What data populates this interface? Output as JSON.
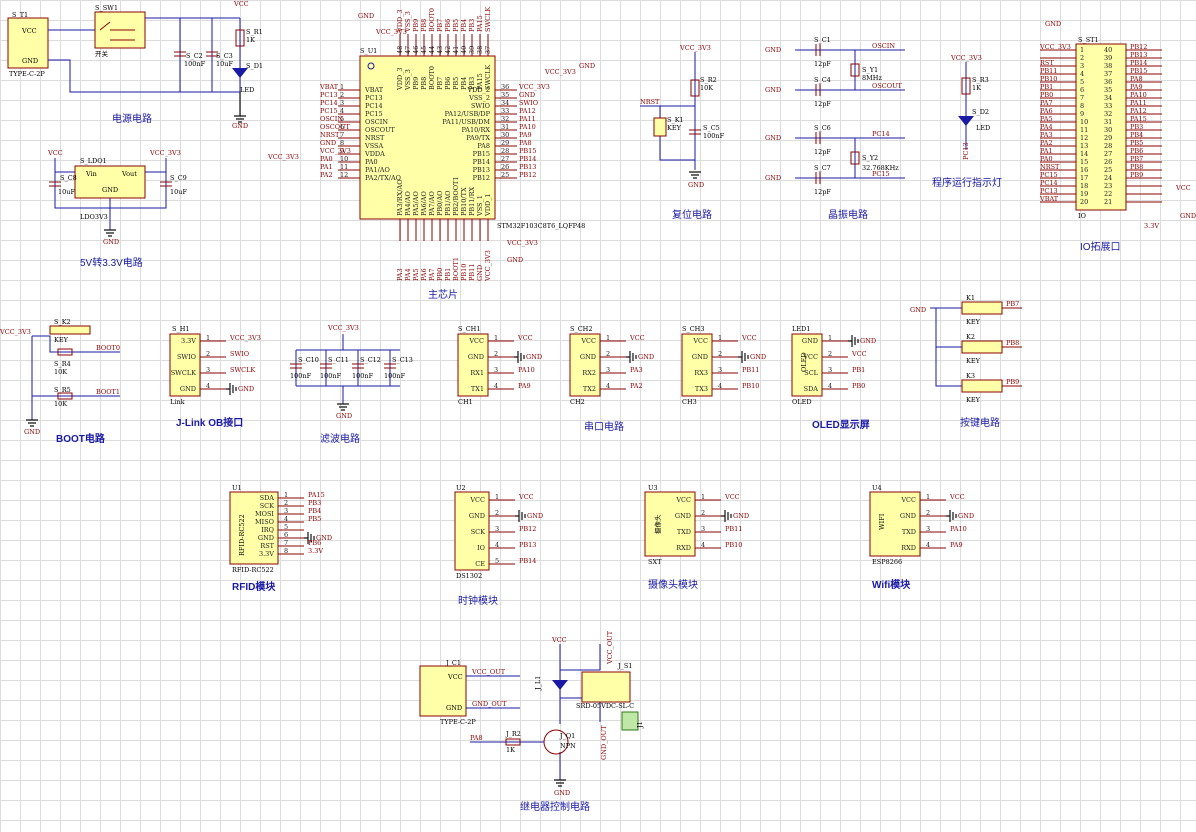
{
  "captions": {
    "power": "电源电路",
    "ldo": "5V转3.3V电路",
    "mcu": "主芯片",
    "reset": "复位电路",
    "crystal": "晶振电路",
    "indicator": "程序运行指示灯",
    "io": "IO拓展口",
    "boot": "BOOT电路",
    "jlink": "J-Link OB接口",
    "filter": "滤波电路",
    "uart": "串口电路",
    "oled": "OLED显示屏",
    "keys": "按键电路",
    "rfid": "RFID模块",
    "clock": "时钟模块",
    "camera": "摄像头模块",
    "wifi": "Wifi模块",
    "relay": "继电器控制电路"
  },
  "power": {
    "t1_ref": "S_T1",
    "t1_name": "TYPE-C-2P",
    "t1_pins": [
      "NC",
      "VCC",
      "NC",
      "GND"
    ],
    "sw_ref": "S_SW1",
    "sw_name": "开关",
    "c2_ref": "S_C2",
    "c2_val": "100nF",
    "c3_ref": "S_C3",
    "c3_val": "10uF",
    "r1_ref": "S_R1",
    "r1_val": "1K",
    "d1_ref": "S_D1",
    "d1_val": "LED",
    "vcc": "VCC",
    "gnd": "GND"
  },
  "ldo": {
    "ref": "S_LDO1",
    "name": "LDO3V3",
    "vin": "Vin",
    "vout": "Vout",
    "gnd_pin": "GND",
    "c8_ref": "S_C8",
    "c8_val": "10uF",
    "c9_ref": "S_C9",
    "c9_val": "10uF",
    "vcc": "VCC",
    "vcc33": "VCC_3V3",
    "gnd": "GND"
  },
  "mcu": {
    "ref": "S_U1",
    "part": "STM32F103C8T6_LQFP48",
    "left_pins": [
      {
        "n": "1",
        "name": "VBAT",
        "net": "VBAT"
      },
      {
        "n": "2",
        "name": "PC13",
        "net": "PC13"
      },
      {
        "n": "3",
        "name": "PC14",
        "net": "PC14"
      },
      {
        "n": "4",
        "name": "PC15",
        "net": "PC15"
      },
      {
        "n": "5",
        "name": "OSCIN",
        "net": "OSCIN"
      },
      {
        "n": "6",
        "name": "OSCOUT",
        "net": "OSCOUT"
      },
      {
        "n": "7",
        "name": "NRST",
        "net": "NRST"
      },
      {
        "n": "8",
        "name": "VSSA",
        "net": "GND"
      },
      {
        "n": "9",
        "name": "VDDA",
        "net": "VCC_3V3"
      },
      {
        "n": "10",
        "name": "PA0",
        "net": "PA0"
      },
      {
        "n": "11",
        "name": "PA1/AO",
        "net": "PA1"
      },
      {
        "n": "12",
        "name": "PA2/TX/AO",
        "net": "PA2"
      }
    ],
    "right_pins": [
      {
        "n": "36",
        "name": "VDD_2",
        "net": "VCC_3V3"
      },
      {
        "n": "35",
        "name": "VSS_2",
        "net": "GND"
      },
      {
        "n": "34",
        "name": "SWIO",
        "net": "SWIO"
      },
      {
        "n": "33",
        "name": "PA12/USB/DP",
        "net": "PA12"
      },
      {
        "n": "32",
        "name": "PA11/USB/DM",
        "net": "PA11"
      },
      {
        "n": "31",
        "name": "PA10/RX",
        "net": "PA10"
      },
      {
        "n": "30",
        "name": "PA9/TX",
        "net": "PA9"
      },
      {
        "n": "29",
        "name": "PA8",
        "net": "PA8"
      },
      {
        "n": "28",
        "name": "PB15",
        "net": "PB15"
      },
      {
        "n": "27",
        "name": "PB14",
        "net": "PB14"
      },
      {
        "n": "26",
        "name": "PB13",
        "net": "PB13"
      },
      {
        "n": "25",
        "name": "PB12",
        "net": "PB12"
      }
    ],
    "top_pins": [
      "VDD_3",
      "VSS_3",
      "PB9",
      "PB8",
      "BOOT0",
      "PB7",
      "PB6",
      "PB5",
      "PB4",
      "PB3",
      "PA15",
      "SWCLK"
    ],
    "top_nums": [
      "48",
      "47",
      "46",
      "45",
      "44",
      "43",
      "42",
      "41",
      "40",
      "39",
      "38",
      "37"
    ],
    "bottom_pins": [
      "PA3/RX/AO",
      "PA4/AO",
      "PA5/AO",
      "PA6/AO",
      "PA7/AO",
      "PB0/AO",
      "PB1/AO",
      "PB2/BOOT1",
      "PB10/TX",
      "PB11/RX",
      "VSS_1",
      "VDD_1"
    ],
    "bottom_nets": [
      "PA3",
      "PA4",
      "PA5",
      "PA6",
      "PA7",
      "PB0",
      "PB1",
      "BOOT1",
      "PB10",
      "PB11",
      "GND",
      "VCC_3V3"
    ],
    "gnd": "GND",
    "vcc33": "VCC_3V3"
  },
  "reset": {
    "vcc33": "VCC_3V3",
    "r_ref": "S_R2",
    "r_val": "10K",
    "nrst": "NRST",
    "k_ref": "S_K1",
    "k_name": "KEY",
    "c_ref": "S_C5",
    "c_val": "100nF",
    "gnd": "GND"
  },
  "crystal": {
    "c1_ref": "S_C1",
    "c4_ref": "S_C4",
    "c6_ref": "S_C6",
    "c7_ref": "S_C7",
    "cap_val": "12pF",
    "y1_ref": "S_Y1",
    "y1_val": "8MHz",
    "y2_ref": "S_Y2",
    "y2_val": "32.768KHz",
    "oscin": "OSCIN",
    "oscout": "OSCOUT",
    "pc14": "PC14",
    "pc15": "PC15",
    "gnd": "GND"
  },
  "indicator": {
    "vcc33": "VCC_3V3",
    "r_ref": "S_R3",
    "r_val": "1K",
    "d_ref": "S_D2",
    "d_val": "LED",
    "pc13": "PC13"
  },
  "io": {
    "ref": "S_ST1",
    "name": "IO",
    "vcc33": "VCC_3V3",
    "v33": "3.3V",
    "gnd": "GND",
    "vcc": "VCC",
    "left_nets": [
      "VCC_3V3",
      "",
      "RST",
      "PB11",
      "PB10",
      "PB1",
      "PB0",
      "PA7",
      "PA6",
      "PA5",
      "PA4",
      "PA3",
      "PA2",
      "PA1",
      "PA0",
      "NRST",
      "PC15",
      "PC14",
      "PC13",
      "VBAT"
    ],
    "right_nets": [
      "PB12",
      "PB13",
      "PB14",
      "PB15",
      "PA8",
      "PA9",
      "PA10",
      "PA11",
      "PA12",
      "PA15",
      "PB3",
      "PB4",
      "PB5",
      "PB6",
      "PB7",
      "PB8",
      "PB9",
      "",
      "",
      ""
    ]
  },
  "boot": {
    "vcc33": "VCC_3V3",
    "k_ref": "S_K2",
    "k_name": "KEY",
    "r4_ref": "S_R4",
    "r4_val": "10K",
    "r5_ref": "S_R5",
    "r5_val": "10K",
    "boot0": "BOOT0",
    "boot1": "BOOT1",
    "gnd": "GND"
  },
  "jlink": {
    "ref": "S_H1",
    "name": "Link",
    "pins": [
      "3.3V",
      "SWIO",
      "SWCLK",
      "GND"
    ],
    "nets": [
      "VCC_3V3",
      "SWIO",
      "SWCLK",
      "GND"
    ]
  },
  "filter": {
    "vcc33": "VCC_3V3",
    "caps": [
      {
        "ref": "S_C10",
        "val": "100nF"
      },
      {
        "ref": "S_C11",
        "val": "100nF"
      },
      {
        "ref": "S_C12",
        "val": "100nF"
      },
      {
        "ref": "S_C13",
        "val": "100nF"
      }
    ],
    "gnd": "GND"
  },
  "uart": [
    {
      "ref": "S_CH1",
      "name": "CH1",
      "pins": [
        "VCC",
        "GND",
        "RX1",
        "TX1"
      ],
      "nets": [
        "VCC",
        "GND",
        "PA10",
        "PA9"
      ]
    },
    {
      "ref": "S_CH2",
      "name": "CH2",
      "pins": [
        "VCC",
        "GND",
        "RX2",
        "TX2"
      ],
      "nets": [
        "VCC",
        "GND",
        "PA3",
        "PA2"
      ]
    },
    {
      "ref": "S_CH3",
      "name": "CH3",
      "pins": [
        "VCC",
        "GND",
        "RX3",
        "TX3"
      ],
      "nets": [
        "VCC",
        "GND",
        "PB11",
        "PB10"
      ]
    }
  ],
  "oled": {
    "ref": "LED1",
    "name": "OLED",
    "body": "OLED",
    "pins": [
      "GND",
      "VCC",
      "SCL",
      "SDA"
    ],
    "nets": [
      "GND",
      "VCC",
      "PB1",
      "PB0"
    ]
  },
  "keys": {
    "gnd": "GND",
    "items": [
      {
        "ref": "K1",
        "name": "KEY",
        "net": "PB7"
      },
      {
        "ref": "K2",
        "name": "KEY",
        "net": "PB8"
      },
      {
        "ref": "K3",
        "name": "KEY",
        "net": "PB9"
      }
    ]
  },
  "rfid": {
    "ref": "U1",
    "name": "RFID-RC522",
    "body": "RFID-RC522",
    "pins": [
      "SDA",
      "SCK",
      "MOSI",
      "MISO",
      "IRQ",
      "GND",
      "RST",
      "3.3V"
    ],
    "nets": [
      "PA15",
      "PB3",
      "PB4",
      "PB5",
      "",
      "GND",
      "PB6",
      "3.3V"
    ]
  },
  "clock": {
    "ref": "U2",
    "name": "DS1302",
    "pins": [
      "VCC",
      "GND",
      "SCK",
      "IO",
      "CE"
    ],
    "nets": [
      "VCC",
      "GND",
      "PB12",
      "PB13",
      "PB14"
    ]
  },
  "camera": {
    "ref": "U3",
    "name": "SXT",
    "body": "摄像头",
    "pins": [
      "VCC",
      "GND",
      "TXD",
      "RXD"
    ],
    "nets": [
      "VCC",
      "GND",
      "PB11",
      "PB10"
    ]
  },
  "wifi": {
    "ref": "U4",
    "name": "ESP8266",
    "body": "WIFI",
    "pins": [
      "VCC",
      "GND",
      "TXD",
      "RXD"
    ],
    "nets": [
      "VCC",
      "GND",
      "PA10",
      "PA9"
    ]
  },
  "relay": {
    "jc_ref": "J_C1",
    "jc_name": "TYPE-C-2P",
    "jc_pins": [
      "NC",
      "VCC",
      "NC",
      "GND"
    ],
    "vcc_out": "VCC_OUT",
    "gnd_out": "GND_OUT",
    "vcc": "VCC",
    "r_ref": "J_R2",
    "r_val": "1K",
    "pa8": "PA8",
    "q_ref": "J_Q1",
    "q_type": "NPN",
    "l_ref": "J_L1",
    "rel_ref": "J_S1",
    "rel_part": "SRD-05VDC-SL-C",
    "jout": "J1",
    "gnd": "GND"
  }
}
